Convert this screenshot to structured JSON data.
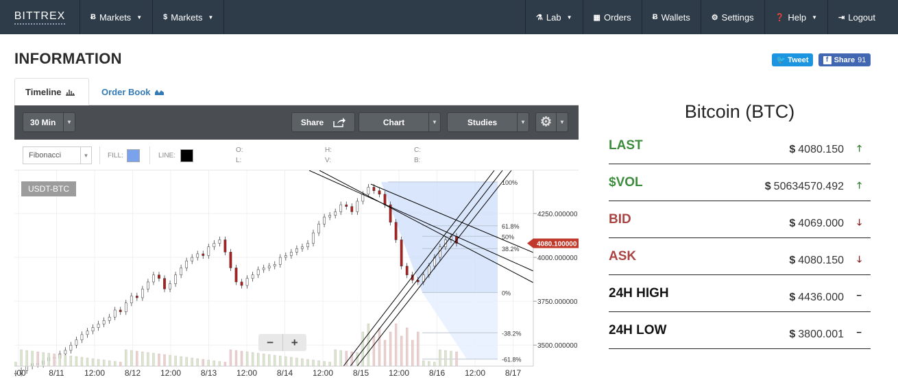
{
  "nav": {
    "brand": "BITTREX",
    "left": [
      {
        "icon": "Ƀ",
        "label": "Markets"
      },
      {
        "icon": "$",
        "label": "Markets"
      }
    ],
    "right": [
      {
        "icon": "⚗",
        "label": "Lab",
        "caret": true
      },
      {
        "icon": "▦",
        "label": "Orders",
        "caret": false
      },
      {
        "icon": "Ƀ",
        "label": "Wallets",
        "caret": false
      },
      {
        "icon": "⚙",
        "label": "Settings",
        "caret": false
      },
      {
        "icon": "❓",
        "label": "Help",
        "caret": true
      },
      {
        "icon": "⇥",
        "label": "Logout",
        "caret": false
      }
    ]
  },
  "page": {
    "title": "INFORMATION"
  },
  "social": {
    "tweet_label": "Tweet",
    "share_label": "Share",
    "share_count": "91"
  },
  "tabs": {
    "timeline": "Timeline",
    "order_book": "Order Book"
  },
  "toolbar": {
    "interval": "30 Min",
    "share": "Share",
    "chart": "Chart",
    "studies": "Studies"
  },
  "drawing": {
    "tool": "Fibonacci",
    "fill_label": "FILL:",
    "line_label": "LINE:",
    "fill_color": "#7aa3ec",
    "line_color": "#000000",
    "ohlc_labels": [
      "O:",
      "L:",
      "H:",
      "V:",
      "C:",
      "B:"
    ]
  },
  "chart": {
    "symbol": "USDT-BTC",
    "current_price_label": "4080.100000",
    "y_tick_labels": [
      "4250.000000",
      "4000.000000",
      "3750.000000",
      "3500.000000"
    ],
    "x_tick_labels": [
      ":00",
      "8/11",
      "12:00",
      "8/12",
      "12:00",
      "8/13",
      "12:00",
      "8/14",
      "12:00",
      "8/15",
      "12:00",
      "8/16",
      "12:00",
      "8/17"
    ],
    "fib_levels": [
      "100%",
      "61.8%",
      "50%",
      "38.2%",
      "0%",
      "-38.2%",
      "-61.8%"
    ],
    "zoom_out": "−",
    "zoom_in": "+"
  },
  "chart_data": {
    "type": "candlestick",
    "x_labels": [
      ":00",
      "8/11",
      "12:00",
      "8/12",
      "12:00",
      "8/13",
      "12:00",
      "8/14",
      "12:00",
      "8/15",
      "12:00",
      "8/16",
      "12:00",
      "8/17"
    ],
    "y_ticks": [
      4250,
      4000,
      3750,
      3500
    ],
    "ylim": [
      3380,
      4480
    ],
    "close_series": [
      3340,
      3355,
      3380,
      3395,
      3390,
      3410,
      3430,
      3425,
      3450,
      3470,
      3500,
      3530,
      3560,
      3580,
      3600,
      3620,
      3640,
      3660,
      3700,
      3690,
      3740,
      3780,
      3770,
      3820,
      3860,
      3900,
      3880,
      3820,
      3850,
      3900,
      3940,
      3980,
      4000,
      4020,
      4010,
      4060,
      4080,
      4100,
      4030,
      3940,
      3860,
      3840,
      3880,
      3900,
      3930,
      3940,
      3950,
      3960,
      4000,
      4010,
      4030,
      4050,
      4060,
      4080,
      4140,
      4190,
      4230,
      4240,
      4260,
      4300,
      4290,
      4260,
      4320,
      4360,
      4400,
      4380,
      4360,
      4300,
      4200,
      4100,
      3950,
      3900,
      3870,
      3860,
      3900,
      3950,
      4000,
      4060,
      4100,
      4120,
      4080
    ],
    "fib_price_levels": {
      "100%": 4430,
      "61.8%": 4180,
      "50%": 4120,
      "38.2%": 4050,
      "0%": 3800,
      "-38.2%": 3570,
      "-61.8%": 3420
    },
    "current_price": 4080.1
  },
  "stats": {
    "title": "Bitcoin (BTC)",
    "rows": [
      {
        "label": "LAST",
        "value": "4080.150",
        "label_color": "#3d8b3d",
        "arrow": "🡑",
        "arrow_color": "#2e7d2e"
      },
      {
        "label": "$VOL",
        "value": "50634570.492",
        "label_color": "#3d8b3d",
        "arrow": "🡑",
        "arrow_color": "#2e7d2e"
      },
      {
        "label": "BID",
        "value": "4069.000",
        "label_color": "#a94442",
        "arrow": "🡓",
        "arrow_color": "#8a1f1f"
      },
      {
        "label": "ASK",
        "value": "4080.150",
        "label_color": "#a94442",
        "arrow": "🡓",
        "arrow_color": "#8a1f1f"
      },
      {
        "label": "24H HIGH",
        "value": "4436.000",
        "label_color": "#111111",
        "arrow": "−",
        "arrow_color": "#111111"
      },
      {
        "label": "24H LOW",
        "value": "3800.001",
        "label_color": "#111111",
        "arrow": "−",
        "arrow_color": "#111111"
      }
    ]
  }
}
